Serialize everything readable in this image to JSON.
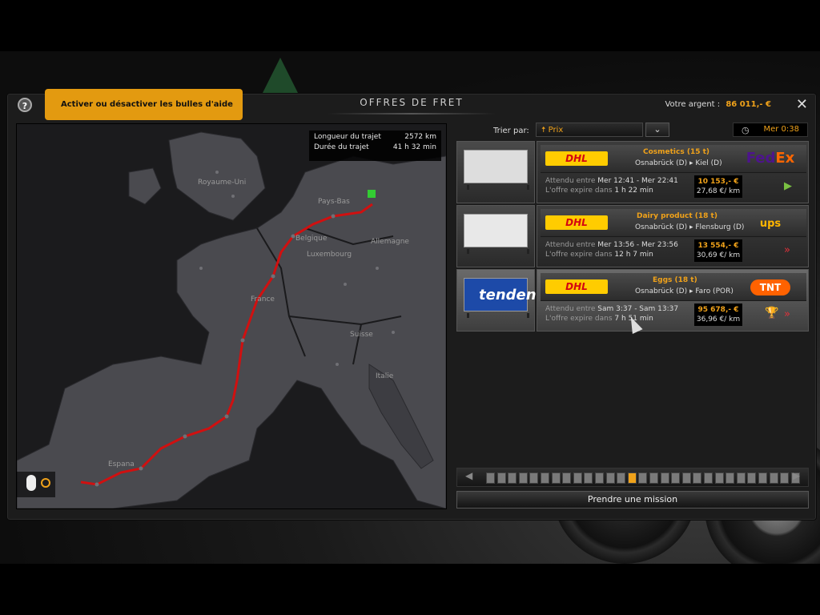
{
  "window": {
    "title": "OFFRES DE FRET",
    "money_label": "Votre argent :",
    "money_value": "86 011,- €",
    "close_icon": "close-icon"
  },
  "help": {
    "button_label": "?",
    "tooltip": "Activer ou désactiver les bulles d'aide"
  },
  "map": {
    "route_length_label": "Longueur du trajet",
    "route_length_value": "2572 km",
    "route_duration_label": "Durée du trajet",
    "route_duration_value": "41 h 32 min",
    "countries": [
      "Royaume-Uni",
      "Pays-Bas",
      "Belgique",
      "Allemagne",
      "Luxembourg",
      "France",
      "Suisse",
      "Italie",
      "Espana"
    ],
    "route_color": "#d01010"
  },
  "sort": {
    "label": "Trier par:",
    "selected": "Prix",
    "dropdown_icon": "chevron-down-icon"
  },
  "clock": {
    "icon": "clock-icon",
    "time": "Mer 0:38"
  },
  "offers": [
    {
      "carrier": "DHL",
      "cargo": "Cosmetics (15 t)",
      "route": "Osnabrück (D) ▸ Kiel (D)",
      "expected_label": "Attendu entre",
      "expected_value": "Mer 12:41 - Mer 22:41",
      "expires_label": "L'offre expire dans",
      "expires_value": "1 h 22 min",
      "price": "10 153,- €",
      "price_per_km": "27,68 €/ km",
      "company": "FedEx",
      "action_icon": "play-arrow-icon",
      "action_color": "#7ac142"
    },
    {
      "carrier": "DHL",
      "cargo": "Dairy product (18 t)",
      "route": "Osnabrück (D) ▸ Flensburg (D)",
      "expected_label": "Attendu entre",
      "expected_value": "Mer 13:56 - Mer 23:56",
      "expires_label": "L'offre expire dans",
      "expires_value": "12 h 7 min",
      "price": "13 554,- €",
      "price_per_km": "30,69 €/ km",
      "company": "ups",
      "action_icon": "fast-forward-icon",
      "action_color": "#e0303a"
    },
    {
      "carrier": "DHL",
      "cargo": "Eggs (18 t)",
      "route": "Osnabrück (D) ▸ Faro (POR)",
      "expected_label": "Attendu entre",
      "expected_value": "Sam 3:37 - Sam 13:37",
      "expires_label": "L'offre expire dans",
      "expires_value": "7 h 51 min",
      "price": "95 678,- €",
      "price_per_km": "36,96 €/ km",
      "company": "TNT",
      "action_icon": "fast-forward-icon",
      "action_color": "#e0303a",
      "trophy_icon": "trophy-icon"
    }
  ],
  "trailer_thumbs": [
    {
      "text": "",
      "color": "#dddddd"
    },
    {
      "text": "",
      "color": "#e8e8e8"
    },
    {
      "text": "tenden",
      "color": "#1d4aa8"
    }
  ],
  "pager": {
    "segments": 29,
    "active_index": 13
  },
  "take_mission_label": "Prendre une mission"
}
